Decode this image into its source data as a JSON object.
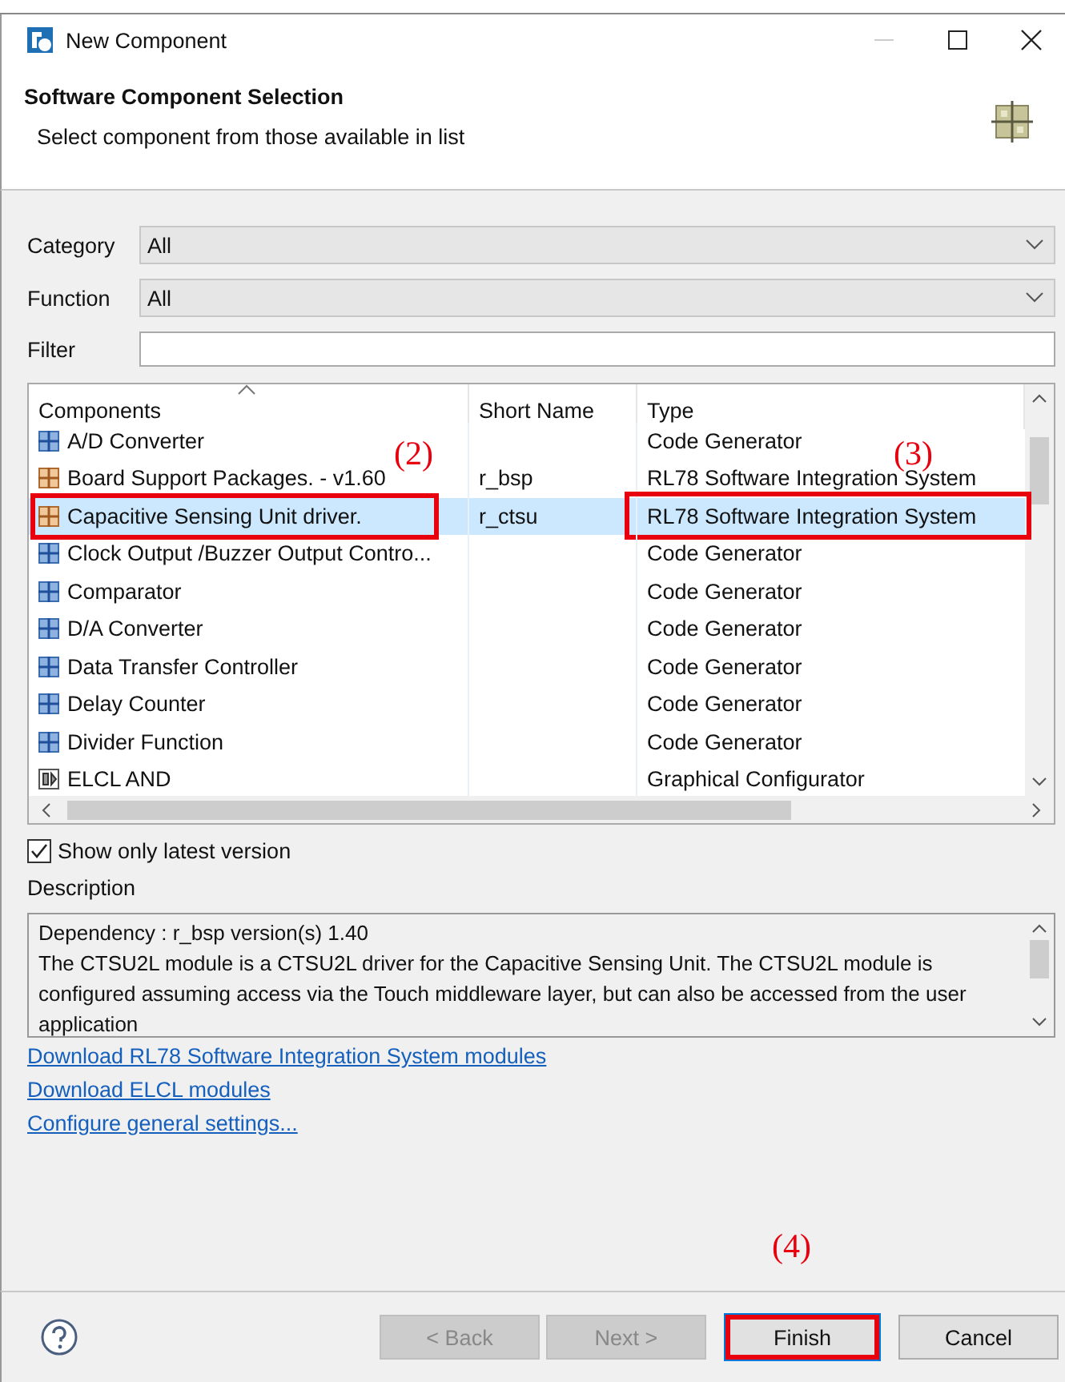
{
  "window": {
    "title": "New Component"
  },
  "header": {
    "title": "Software Component Selection",
    "subtitle": "Select component from those available in list"
  },
  "filters": [
    {
      "label": "Category",
      "kind": "dropdown",
      "value": "All"
    },
    {
      "label": "Function",
      "kind": "dropdown",
      "value": "All"
    },
    {
      "label": "Filter",
      "kind": "text"
    }
  ],
  "table": {
    "columns": [
      {
        "label": "Components",
        "sorted": true
      },
      {
        "label": "Short Name",
        "sorted": false
      },
      {
        "label": "Type",
        "sorted": false
      }
    ],
    "rows": [
      {
        "kind": "code",
        "name": "A/D Converter",
        "short_name": "",
        "type": "Code Generator",
        "selected": false,
        "callout_name": false,
        "callout_type": false
      },
      {
        "kind": "bsp",
        "name": "Board Support Packages. - v1.60",
        "short_name": "r_bsp",
        "type": "RL78 Software Integration System",
        "selected": false,
        "callout_name": false,
        "callout_type": false
      },
      {
        "kind": "bsp",
        "name": "Capacitive Sensing Unit driver.",
        "short_name": "r_ctsu",
        "type": "RL78 Software Integration System",
        "selected": true,
        "callout_name": true,
        "callout_type": true
      },
      {
        "kind": "code",
        "name": "Clock Output /Buzzer Output Contro...",
        "short_name": "",
        "type": "Code Generator",
        "selected": false,
        "callout_name": false,
        "callout_type": false
      },
      {
        "kind": "code",
        "name": "Comparator",
        "short_name": "",
        "type": "Code Generator",
        "selected": false,
        "callout_name": false,
        "callout_type": false
      },
      {
        "kind": "code",
        "name": "D/A Converter",
        "short_name": "",
        "type": "Code Generator",
        "selected": false,
        "callout_name": false,
        "callout_type": false
      },
      {
        "kind": "code",
        "name": "Data Transfer Controller",
        "short_name": "",
        "type": "Code Generator",
        "selected": false,
        "callout_name": false,
        "callout_type": false
      },
      {
        "kind": "code",
        "name": "Delay Counter",
        "short_name": "",
        "type": "Code Generator",
        "selected": false,
        "callout_name": false,
        "callout_type": false
      },
      {
        "kind": "code",
        "name": "Divider Function",
        "short_name": "",
        "type": "Code Generator",
        "selected": false,
        "callout_name": false,
        "callout_type": false
      },
      {
        "kind": "graphical",
        "name": "ELCL AND",
        "short_name": "",
        "type": "Graphical Configurator",
        "selected": false,
        "callout_name": false,
        "callout_type": false
      }
    ]
  },
  "latest_only": {
    "label": "Show only latest version",
    "checked": true
  },
  "description": {
    "label": "Description",
    "lines": [
      "Dependency : r_bsp version(s) 1.40",
      "The CTSU2L module is a CTSU2L driver for the Capacitive Sensing Unit. The CTSU2L module is configured assuming access via the Touch middleware layer, but can also be accessed from the user application"
    ]
  },
  "links": [
    "Download RL78 Software Integration System modules",
    "Download ELCL modules",
    "Configure general settings..."
  ],
  "annotations": [
    "(2)",
    "(3)",
    "(4)"
  ],
  "buttons": [
    {
      "label": "< Back",
      "disabled": true,
      "callout": false
    },
    {
      "label": "Next >",
      "disabled": true,
      "callout": false
    },
    {
      "label": "Finish",
      "disabled": false,
      "callout": true
    },
    {
      "label": "Cancel",
      "disabled": false,
      "callout": false
    }
  ]
}
